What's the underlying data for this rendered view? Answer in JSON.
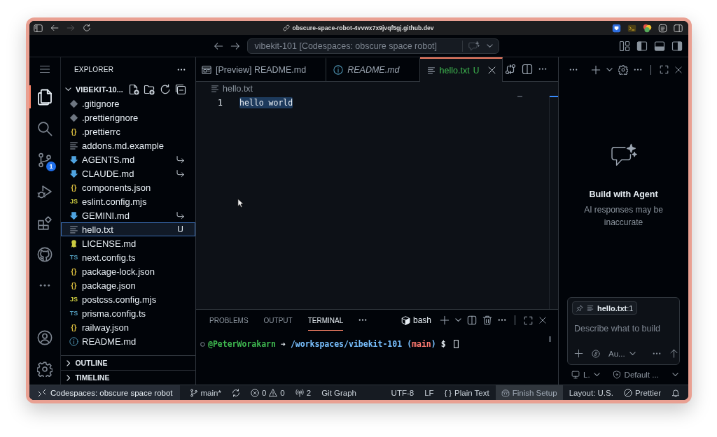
{
  "browser": {
    "forward_disabled": true,
    "url": "obscure-space-robot-4vvwx7x9jvqf5gj.github.dev"
  },
  "title_bar": {
    "command_center": "vibekit-101 [Codespaces: obscure space robot]"
  },
  "activity_bar": {
    "top": [
      {
        "kind": "menu",
        "selected": false
      },
      {
        "kind": "explorer",
        "selected": true
      },
      {
        "kind": "search",
        "selected": false
      },
      {
        "kind": "source-control",
        "selected": false,
        "badge": "1"
      },
      {
        "kind": "run-debug",
        "selected": false
      },
      {
        "kind": "extensions",
        "selected": false
      },
      {
        "kind": "github",
        "selected": false
      },
      {
        "kind": "more",
        "selected": false
      }
    ],
    "bottom": [
      {
        "kind": "accounts",
        "selected": false
      },
      {
        "kind": "settings",
        "selected": false
      }
    ]
  },
  "explorer": {
    "title": "EXPLORER",
    "folder": {
      "name": "VIBEKIT-10...",
      "expanded": true
    },
    "files": [
      {
        "name": ".gitignore",
        "kind": "git",
        "symlink": false,
        "selected": false
      },
      {
        "name": ".prettierignore",
        "kind": "git",
        "symlink": false,
        "selected": false
      },
      {
        "name": ".prettierrc",
        "kind": "json",
        "glyph": "{}",
        "symlink": false,
        "selected": false
      },
      {
        "name": "addons.md.example",
        "kind": "text",
        "symlink": false,
        "selected": false
      },
      {
        "name": "AGENTS.md",
        "kind": "markdown",
        "symlink": true,
        "selected": false
      },
      {
        "name": "CLAUDE.md",
        "kind": "markdown",
        "symlink": true,
        "selected": false
      },
      {
        "name": "components.json",
        "kind": "json",
        "glyph": "{}",
        "symlink": false,
        "selected": false
      },
      {
        "name": "eslint.config.mjs",
        "kind": "js",
        "glyph": "JS",
        "symlink": false,
        "selected": false
      },
      {
        "name": "GEMINI.md",
        "kind": "markdown",
        "symlink": true,
        "selected": false
      },
      {
        "name": "hello.txt",
        "kind": "text",
        "status": "U",
        "symlink": false,
        "selected": true
      },
      {
        "name": "LICENSE.md",
        "kind": "license",
        "symlink": false,
        "selected": false
      },
      {
        "name": "next.config.ts",
        "kind": "ts",
        "glyph": "TS",
        "symlink": false,
        "selected": false
      },
      {
        "name": "package-lock.json",
        "kind": "json",
        "glyph": "{}",
        "symlink": false,
        "selected": false
      },
      {
        "name": "package.json",
        "kind": "json",
        "glyph": "{}",
        "symlink": false,
        "selected": false
      },
      {
        "name": "postcss.config.mjs",
        "kind": "js",
        "glyph": "JS",
        "symlink": false,
        "selected": false
      },
      {
        "name": "prisma.config.ts",
        "kind": "ts",
        "glyph": "TS",
        "symlink": false,
        "selected": false
      },
      {
        "name": "railway.json",
        "kind": "json",
        "glyph": "{}",
        "symlink": false,
        "selected": false
      },
      {
        "name": "README.md",
        "kind": "info",
        "symlink": false,
        "selected": false
      }
    ],
    "sections": [
      {
        "title": "OUTLINE",
        "expanded": false
      },
      {
        "title": "TIMELINE",
        "expanded": false
      }
    ]
  },
  "editor": {
    "tabs": [
      {
        "kind": "preview",
        "label": "[Preview] README.md",
        "italic": false,
        "selected": false
      },
      {
        "kind": "info",
        "label": "README.md",
        "italic": true,
        "selected": false
      },
      {
        "kind": "text",
        "label": "hello.txt",
        "status": "U",
        "italic": false,
        "selected": true
      }
    ],
    "breadcrumb": "hello.txt",
    "lines": [
      {
        "number": "1",
        "text": "hello world",
        "selected": true
      }
    ]
  },
  "panel": {
    "tabs": [
      {
        "label": "PROBLEMS",
        "selected": false
      },
      {
        "label": "OUTPUT",
        "selected": false
      },
      {
        "label": "TERMINAL",
        "selected": true
      }
    ],
    "shell": "bash",
    "prompt": [
      [
        {
          "text": "@PeterWorakarn",
          "color": "#3fb950"
        }
      ],
      [
        {
          "text": "➜"
        }
      ],
      [
        {
          "text": "/workspaces/vibekit-101",
          "color": "#79c0ff"
        }
      ],
      [
        {
          "text": "(",
          "color": "#79c0ff"
        },
        {
          "text": "main",
          "color": "#ff7b72"
        },
        {
          "text": ")",
          "color": "#79c0ff"
        }
      ],
      [
        {
          "text": "$"
        }
      ]
    ]
  },
  "chat": {
    "title": "Build with Agent",
    "subtitle": "AI responses may be inaccurate",
    "context": "**hello.txt**:1",
    "input": {
      "placeholder": "Describe what to build"
    },
    "mode": "Au...",
    "options": [
      {
        "kind": "device",
        "label": "L."
      },
      {
        "kind": "approval",
        "label": "Default ..."
      }
    ]
  },
  "status_bar": {
    "remote": "Codespaces: obscure space robot",
    "left": [
      {
        "kind": "branch",
        "text": "main*",
        "highlighted": false
      },
      {
        "kind": "sync",
        "highlighted": false
      },
      {
        "kind": "problems",
        "errors": "0",
        "warnings": "0",
        "highlighted": false
      },
      {
        "kind": "ports",
        "text": "2",
        "highlighted": false
      },
      {
        "kind": "plain",
        "text": "Git Graph",
        "highlighted": false
      }
    ],
    "right": [
      {
        "kind": "plain",
        "text": "UTF-8",
        "highlighted": false
      },
      {
        "kind": "plain",
        "text": "LF",
        "highlighted": false
      },
      {
        "kind": "language",
        "glyph": "{ }",
        "text": "Plain Text",
        "highlighted": false
      },
      {
        "kind": "copilot",
        "text": "Finish Setup",
        "highlighted": true
      },
      {
        "kind": "plain",
        "text": "Layout: U.S.",
        "highlighted": false
      },
      {
        "kind": "prettier",
        "text": "Prettier",
        "highlighted": false
      },
      {
        "kind": "bell",
        "highlighted": false
      }
    ]
  }
}
